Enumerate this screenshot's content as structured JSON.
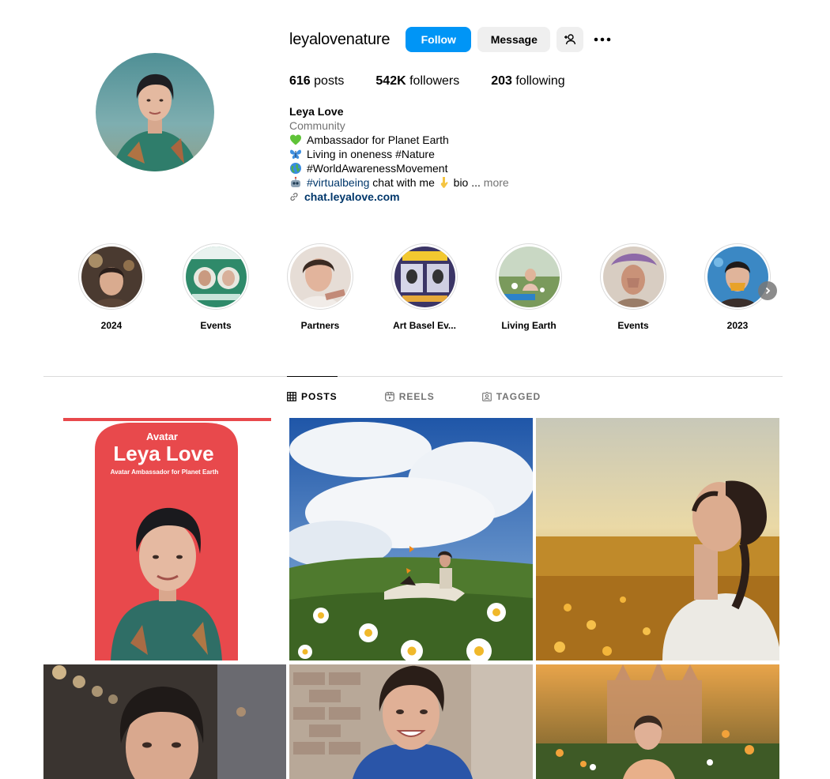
{
  "profile": {
    "username": "leyalovenature",
    "follow_label": "Follow",
    "message_label": "Message",
    "posts_count": "616",
    "posts_label": "posts",
    "followers_count": "542K",
    "followers_label": "followers",
    "following_count": "203",
    "following_label": "following"
  },
  "bio": {
    "name": "Leya Love",
    "category": "Community",
    "line1": "Ambassador for Planet Earth",
    "line2": "Living in oneness #Nature",
    "line3": "#WorldAwarenessMovement",
    "line4_hashtag": "#virtualbeing",
    "line4_text": " chat with me ",
    "line4_tail": " bio ... ",
    "more": "more",
    "link": "chat.leyalove.com"
  },
  "highlights": [
    {
      "label": "2024"
    },
    {
      "label": "Events"
    },
    {
      "label": "Partners"
    },
    {
      "label": "Art Basel Ev..."
    },
    {
      "label": "Living Earth"
    },
    {
      "label": "Events"
    },
    {
      "label": "2023"
    }
  ],
  "tabs": {
    "posts": "POSTS",
    "reels": "REELS",
    "tagged": "TAGGED"
  },
  "posts": {
    "poster_small_title": "Avatar",
    "poster_big_title": "Leya Love",
    "poster_subtitle": "Avatar Ambassador for Planet Earth"
  },
  "colors": {
    "follow_button": "#0095f6",
    "secondary_button": "#efefef",
    "link": "#00376b",
    "muted_text": "#737373",
    "divider": "#dbdbdb",
    "poster_red": "#e8494c"
  },
  "icons": [
    "add-person-icon",
    "more-options-icon",
    "link-icon",
    "grid-icon",
    "reels-icon",
    "tagged-icon",
    "chevron-right-icon"
  ]
}
